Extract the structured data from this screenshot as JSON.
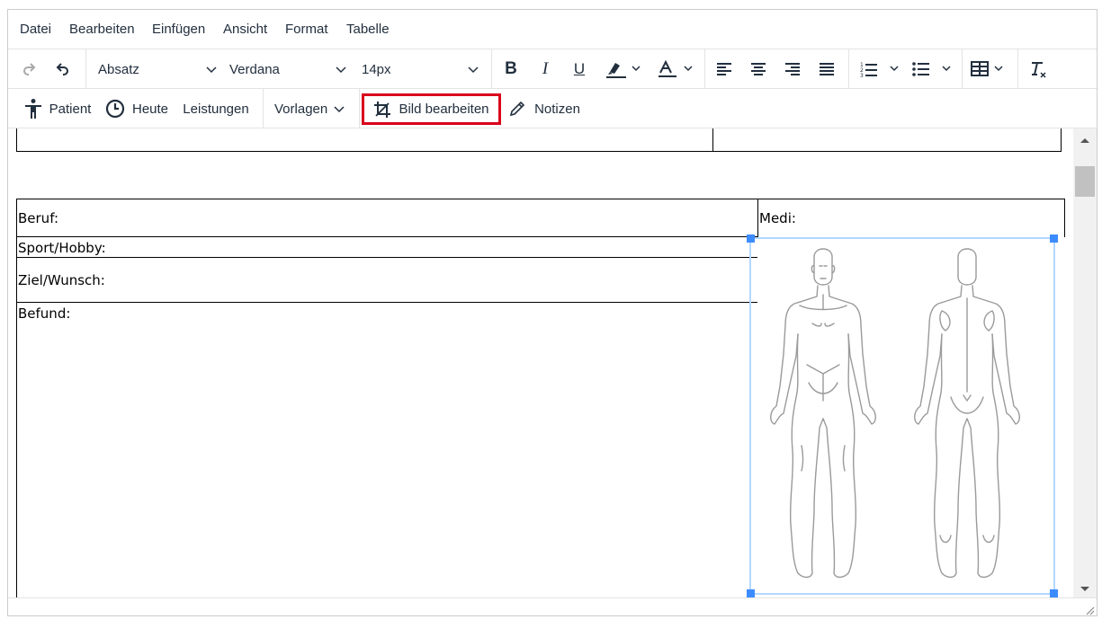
{
  "menubar": {
    "items": [
      "Datei",
      "Bearbeiten",
      "Einfügen",
      "Ansicht",
      "Format",
      "Tabelle"
    ]
  },
  "toolbar1": {
    "block_format": "Absatz",
    "font_family": "Verdana",
    "font_size": "14px",
    "bold_label": "B",
    "italic_label": "I",
    "underline_label": "U",
    "text_color_label": "A",
    "icons": [
      "redo-icon",
      "undo-icon",
      "bold-icon",
      "italic-icon",
      "underline-icon",
      "highlight-icon",
      "text-color-icon",
      "align-left-icon",
      "align-center-icon",
      "align-right-icon",
      "justify-icon",
      "numbered-list-icon",
      "bullet-list-icon",
      "table-icon",
      "clear-format-icon"
    ]
  },
  "toolbar2": {
    "patient": "Patient",
    "heute": "Heute",
    "leistungen": "Leistungen",
    "vorlagen": "Vorlagen",
    "bild_bearbeiten": "Bild bearbeiten",
    "notizen": "Notizen",
    "highlight_color": "#d9001b"
  },
  "document": {
    "beruf": "Beruf:",
    "medi": "Medi:",
    "sport": "Sport/Hobby:",
    "ziel": "Ziel/Wunsch:",
    "befund": "Befund:"
  },
  "colors": {
    "selection_border": "#b4d7ff",
    "handle": "#3d8cff",
    "body_outline": "#9a9a9a"
  }
}
